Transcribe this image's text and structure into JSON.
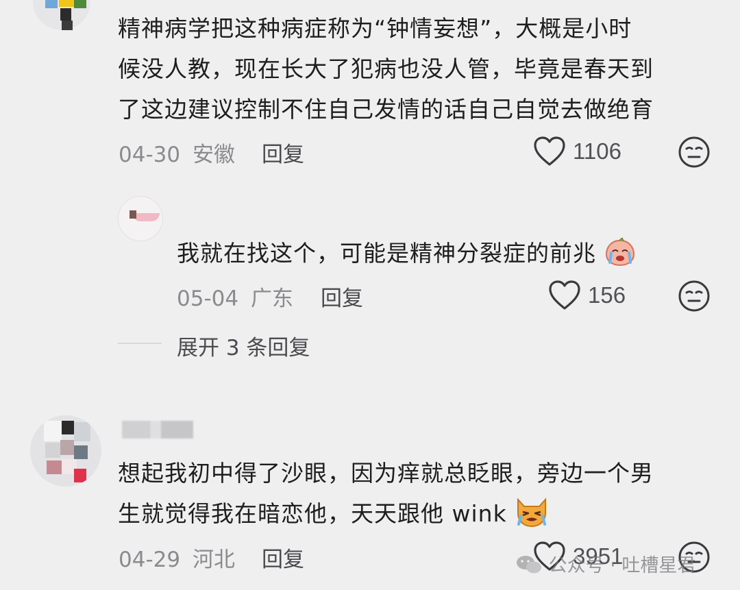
{
  "comments": [
    {
      "lines": [
        "精神病学把这种病症称为“钟情妄想”，大概是小时",
        "候没人教，现在长大了犯病也没人管，毕竟是春天到",
        "了这边建议控制不住自己发情的话自己自觉去做绝育"
      ],
      "date": "04-30",
      "location": "安徽",
      "reply_label": "回复",
      "likes": "1106",
      "replies": [
        {
          "text": "我就在找这个，可能是精神分裂症的前兆",
          "date": "05-04",
          "location": "广东",
          "reply_label": "回复",
          "likes": "156"
        }
      ],
      "expand_label": "展开 3 条回复"
    },
    {
      "username": "",
      "lines": [
        "想起我初中得了沙眼，因为痒就总眨眼，旁边一个男",
        "生就觉得我在暗恋他，天天跟他 wink"
      ],
      "date": "04-29",
      "location": "河北",
      "reply_label": "回复",
      "likes": "3951"
    }
  ],
  "watermark": {
    "text": "公众号 · 吐槽星君"
  },
  "colors": {
    "background": "#efeff0",
    "text": "#1e1e1e",
    "meta": "#8b8b8f",
    "icon": "#3a3a3e"
  }
}
